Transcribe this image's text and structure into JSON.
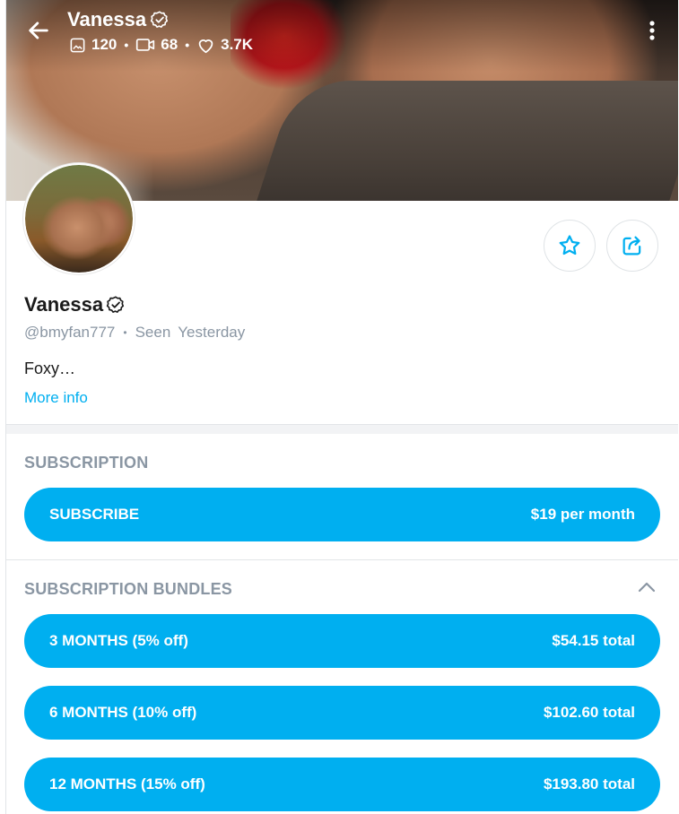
{
  "header": {
    "title": "Vanessa",
    "stats": {
      "photos": "120",
      "videos": "68",
      "likes": "3.7K"
    },
    "icons": {
      "back": "arrow-left-icon",
      "verified": "verified-badge-icon",
      "photos": "image-icon",
      "videos": "video-icon",
      "likes": "heart-icon",
      "menu": "kebab-menu-icon"
    }
  },
  "profile": {
    "name": "Vanessa",
    "handle": "@bmyfan777",
    "seen_label": "Seen",
    "seen_value": "Yesterday",
    "bio": "Foxy…",
    "more_info": "More info",
    "actions": [
      {
        "icon": "star-icon"
      },
      {
        "icon": "share-icon"
      }
    ]
  },
  "subscription": {
    "title": "SUBSCRIPTION",
    "button_label": "SUBSCRIBE",
    "button_price": "$19 per month"
  },
  "bundles": {
    "title": "SUBSCRIPTION BUNDLES",
    "expanded": true,
    "items": [
      {
        "label": "3 MONTHS (5% off)",
        "price": "$54.15 total"
      },
      {
        "label": "6 MONTHS (10% off)",
        "price": "$102.60 total"
      },
      {
        "label": "12 MONTHS (15% off)",
        "price": "$193.80 total"
      }
    ]
  },
  "colors": {
    "accent": "#00aff0",
    "muted": "#8a96a3",
    "text": "#1a1a1a"
  }
}
